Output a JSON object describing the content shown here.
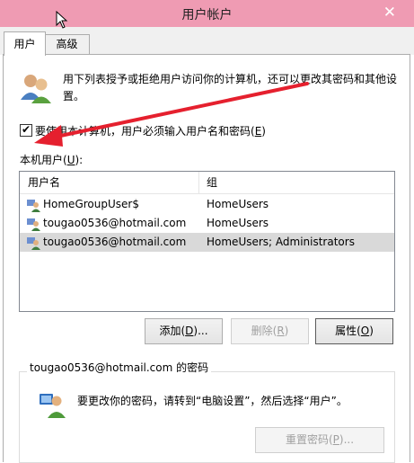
{
  "window": {
    "title": "用户帐户",
    "close_glyph": "✕"
  },
  "tabs": [
    {
      "label": "用户",
      "active": true
    },
    {
      "label": "高级",
      "active": false
    }
  ],
  "description": "用下列表授予或拒绝用户访问你的计算机，还可以更改其密码和其他设置。",
  "require_login": {
    "label_prefix": "要使用本计算机，用户必须输入用户名和密码(",
    "label_key": "E",
    "label_suffix": ")",
    "checked": true,
    "check_glyph": "✔"
  },
  "local_users": {
    "label_prefix": "本机用户(",
    "label_key": "U",
    "label_suffix": "):",
    "columns": [
      "用户名",
      "组"
    ],
    "rows": [
      {
        "name": "HomeGroupUser$",
        "group": "HomeUsers",
        "selected": false
      },
      {
        "name": "tougao0536@hotmail.com",
        "group": "HomeUsers",
        "selected": false
      },
      {
        "name": "tougao0536@hotmail.com",
        "group": "HomeUsers; Administrators",
        "selected": true
      }
    ]
  },
  "buttons": {
    "add": {
      "prefix": "添加(",
      "key": "D",
      "suffix": ")..."
    },
    "remove": {
      "prefix": "删除(",
      "key": "R",
      "suffix": ")"
    },
    "properties": {
      "prefix": "属性(",
      "key": "O",
      "suffix": ")"
    }
  },
  "password_group": {
    "title": "tougao0536@hotmail.com 的密码",
    "message": "要更改你的密码，请转到“电脑设置”，然后选择“用户”。",
    "reset_button": {
      "prefix": "重置密码(",
      "key": "P",
      "suffix": ")..."
    }
  },
  "colors": {
    "titlebar": "#ef9bb3",
    "arrow": "#e5202e",
    "selection": "#d9d9d9"
  },
  "icons": [
    "users-icon",
    "user-icon",
    "lock-user-icon",
    "cursor-icon",
    "annotation-arrow"
  ]
}
